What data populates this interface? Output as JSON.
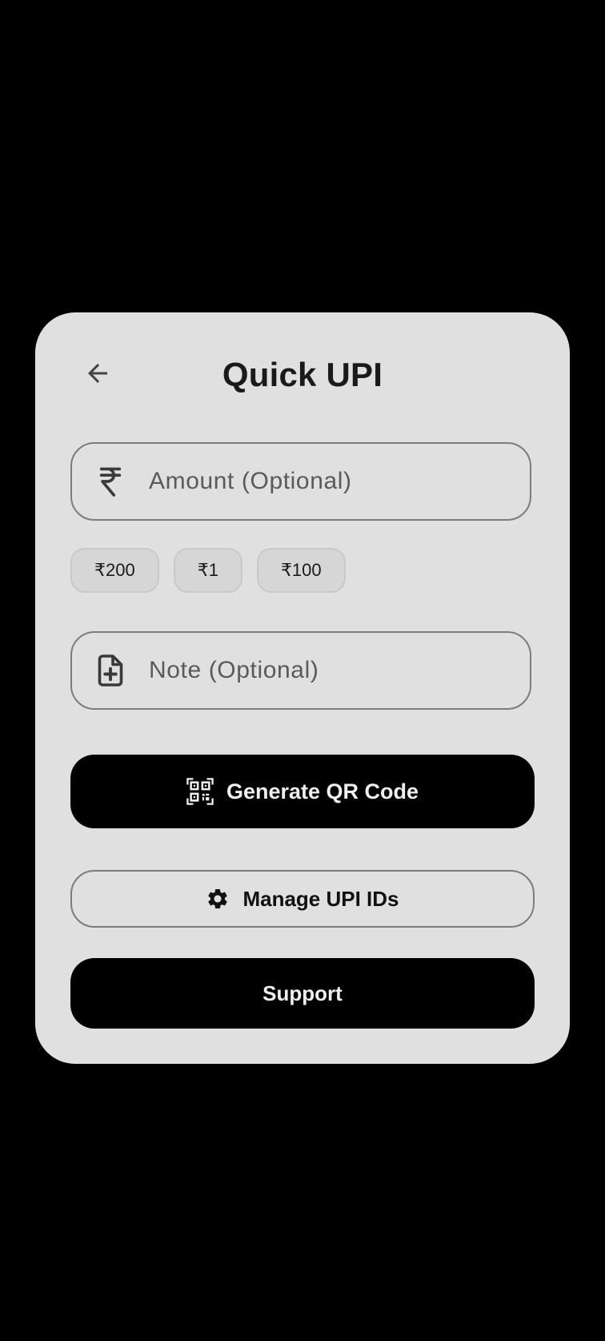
{
  "header": {
    "title": "Quick UPI",
    "back_icon": "arrow-left-icon"
  },
  "amount": {
    "placeholder": "Amount (Optional)",
    "value": "",
    "icon": "rupee-icon"
  },
  "quick_amounts": [
    {
      "label": "₹200"
    },
    {
      "label": "₹1"
    },
    {
      "label": "₹100"
    }
  ],
  "note": {
    "placeholder": "Note (Optional)",
    "value": "",
    "icon": "note-add-icon"
  },
  "actions": {
    "generate_label": "Generate QR Code",
    "generate_icon": "qr-code-icon",
    "manage_label": "Manage UPI IDs",
    "manage_icon": "gear-icon",
    "support_label": "Support"
  },
  "colors": {
    "background": "#000000",
    "card": "#e0e0e0",
    "primary_button": "#000000",
    "primary_text": "#efefef",
    "outline": "#7c7c7c"
  }
}
